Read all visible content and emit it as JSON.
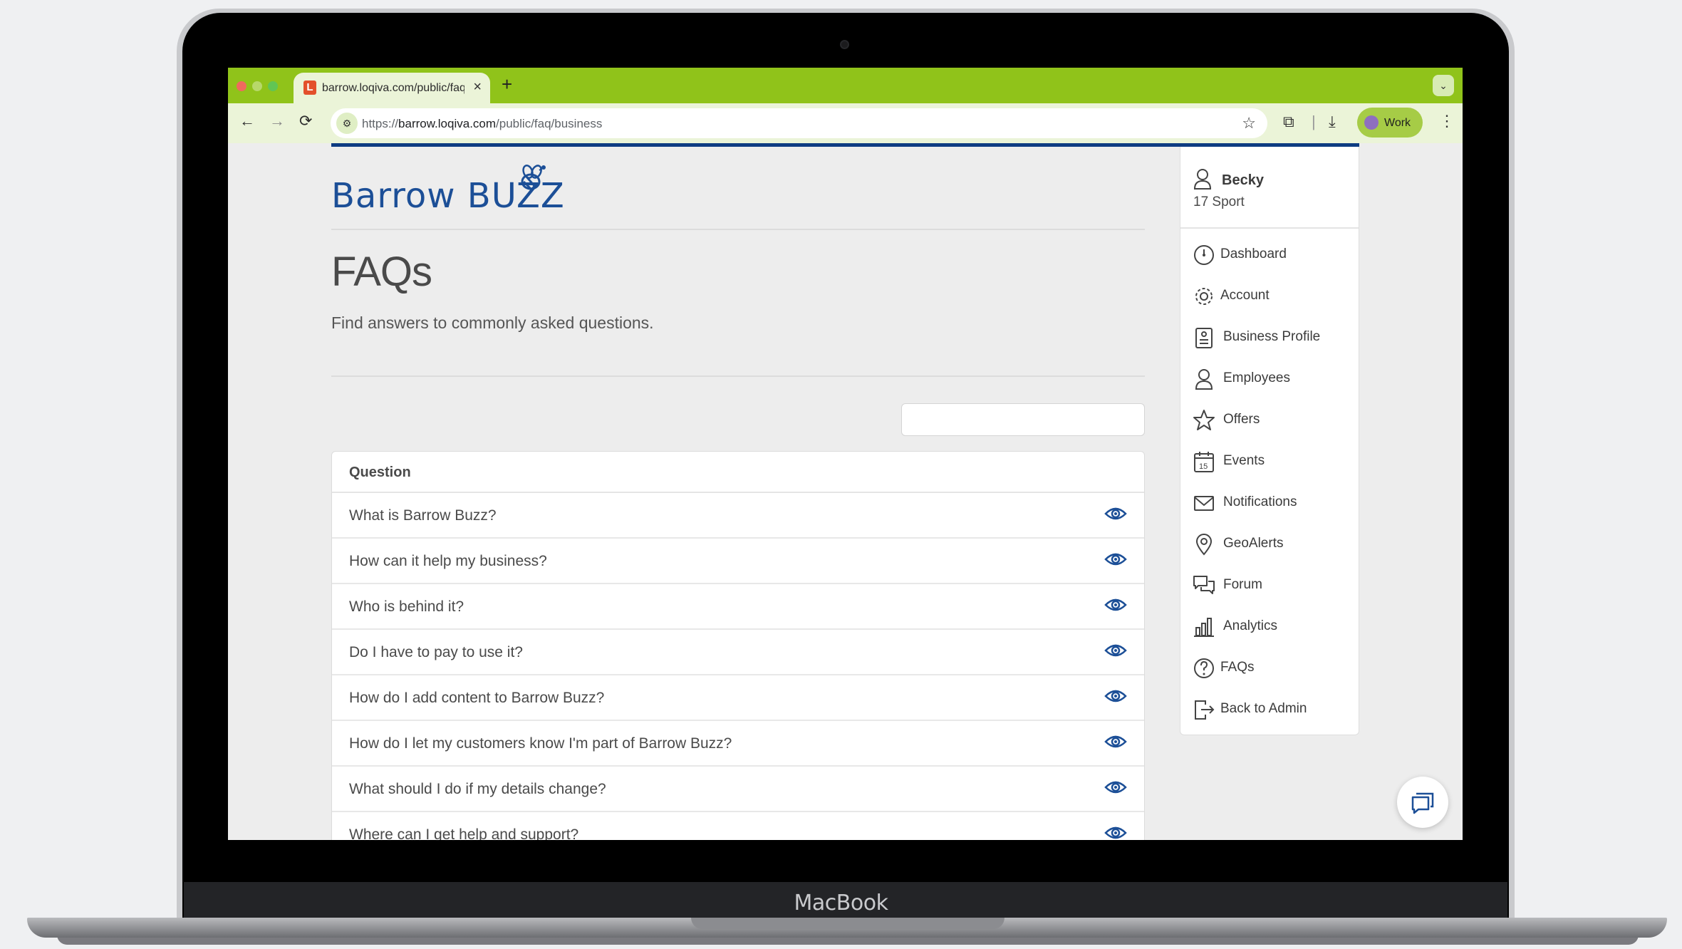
{
  "device": {
    "label": "MacBook"
  },
  "browser": {
    "tab_title": "barrow.loqiva.com/public/faq/business",
    "tab_favicon": "L",
    "url_scheme": "https://",
    "url_host": "barrow.loqiva.com",
    "url_path": "/public/faq/business",
    "profile_label": "Work",
    "accent_color": "#90c31a"
  },
  "logo": {
    "text": "Barrow BUZZ",
    "icon": "bee-icon"
  },
  "page": {
    "title": "FAQs",
    "subtitle": "Find answers to commonly asked questions.",
    "search_value": ""
  },
  "table": {
    "header": "Question",
    "rows": [
      "What is Barrow Buzz?",
      "How can it help my business?",
      "Who is behind it?",
      "Do I have to pay to use it?",
      "How do I add content to Barrow Buzz?",
      "How do I let my customers know I'm part of Barrow Buzz?",
      "What should I do if my details change?",
      "Where can I get help and support?"
    ]
  },
  "sidebar": {
    "user_name": "Becky",
    "user_org": "17 Sport",
    "items": [
      {
        "label": "Dashboard",
        "icon": "dashboard-icon"
      },
      {
        "label": "Account",
        "icon": "gear-icon"
      },
      {
        "label": "Business Profile",
        "icon": "document-icon"
      },
      {
        "label": "Employees",
        "icon": "person-icon"
      },
      {
        "label": "Offers",
        "icon": "star-icon"
      },
      {
        "label": "Events",
        "icon": "calendar-icon"
      },
      {
        "label": "Notifications",
        "icon": "envelope-icon"
      },
      {
        "label": "GeoAlerts",
        "icon": "map-pin-icon"
      },
      {
        "label": "Forum",
        "icon": "chat-bubbles-icon"
      },
      {
        "label": "Analytics",
        "icon": "bar-chart-icon"
      },
      {
        "label": "FAQs",
        "icon": "question-icon"
      },
      {
        "label": "Back to Admin",
        "icon": "exit-icon"
      }
    ]
  },
  "calendar_icon_day": "15"
}
